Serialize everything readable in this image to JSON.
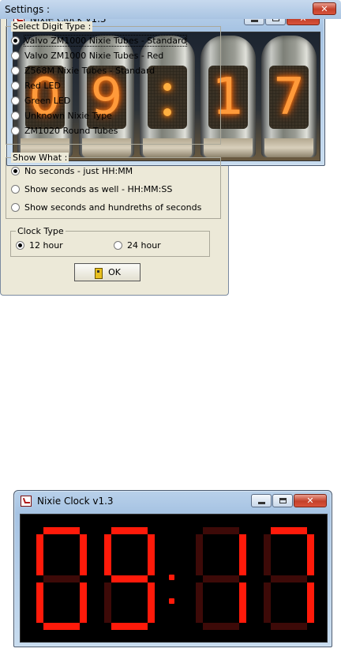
{
  "nixie_window": {
    "title": "Nixie Clock v1.3",
    "digits": [
      "0",
      "9",
      ":",
      "1",
      "7"
    ]
  },
  "settings": {
    "title": "Settings :",
    "digit_type_title": "Select Digit Type :",
    "digit_types": [
      {
        "label": "Valvo ZM1000 Nixie Tubes - Standard",
        "selected": true
      },
      {
        "label": "Valvo ZM1000 Nixie Tubes - Red",
        "selected": false
      },
      {
        "label": "Z568M Nixie Tubes - Standard",
        "selected": false
      },
      {
        "label": "Red LED",
        "selected": false
      },
      {
        "label": "Green LED",
        "selected": false
      },
      {
        "label": "Unknown Nixie Type",
        "selected": false
      },
      {
        "label": "ZM1020 Round Tubes",
        "selected": false
      }
    ],
    "show_what_title": "Show What :",
    "show_what": [
      {
        "label": "No seconds - just HH:MM",
        "selected": true
      },
      {
        "label": "Show seconds as well - HH:MM:SS",
        "selected": false
      },
      {
        "label": "Show seconds and hundreths of seconds",
        "selected": false
      }
    ],
    "clock_type_title": "Clock Type",
    "clock_types": [
      {
        "label": "12 hour",
        "selected": true
      },
      {
        "label": "24 hour",
        "selected": false
      }
    ],
    "ok_label": "OK"
  },
  "led_window": {
    "title": "Nixie Clock v1.3",
    "digits": [
      "0",
      "9",
      ":",
      "1",
      "7"
    ]
  },
  "colors": {
    "nixie_glow": "#ff9a3a",
    "led_on": "#ff1a0a",
    "led_off": "#3d0a08"
  }
}
